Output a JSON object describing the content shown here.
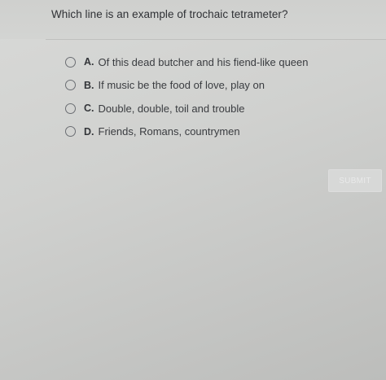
{
  "question": "Which line is an example of trochaic tetrameter?",
  "options": [
    {
      "letter": "A.",
      "text": "Of this dead butcher and his fiend-like queen"
    },
    {
      "letter": "B.",
      "text": "If music be the food of love, play on"
    },
    {
      "letter": "C.",
      "text": "Double, double, toil and trouble"
    },
    {
      "letter": "D.",
      "text": "Friends, Romans, countrymen"
    }
  ],
  "submit_label": "SUBMIT",
  "colors": {
    "background": "#cfd0ce",
    "text": "#3a3c40",
    "radio_border": "#6b6e73",
    "submit_bg": "#d7d8d7",
    "submit_text": "#e9eaea"
  }
}
